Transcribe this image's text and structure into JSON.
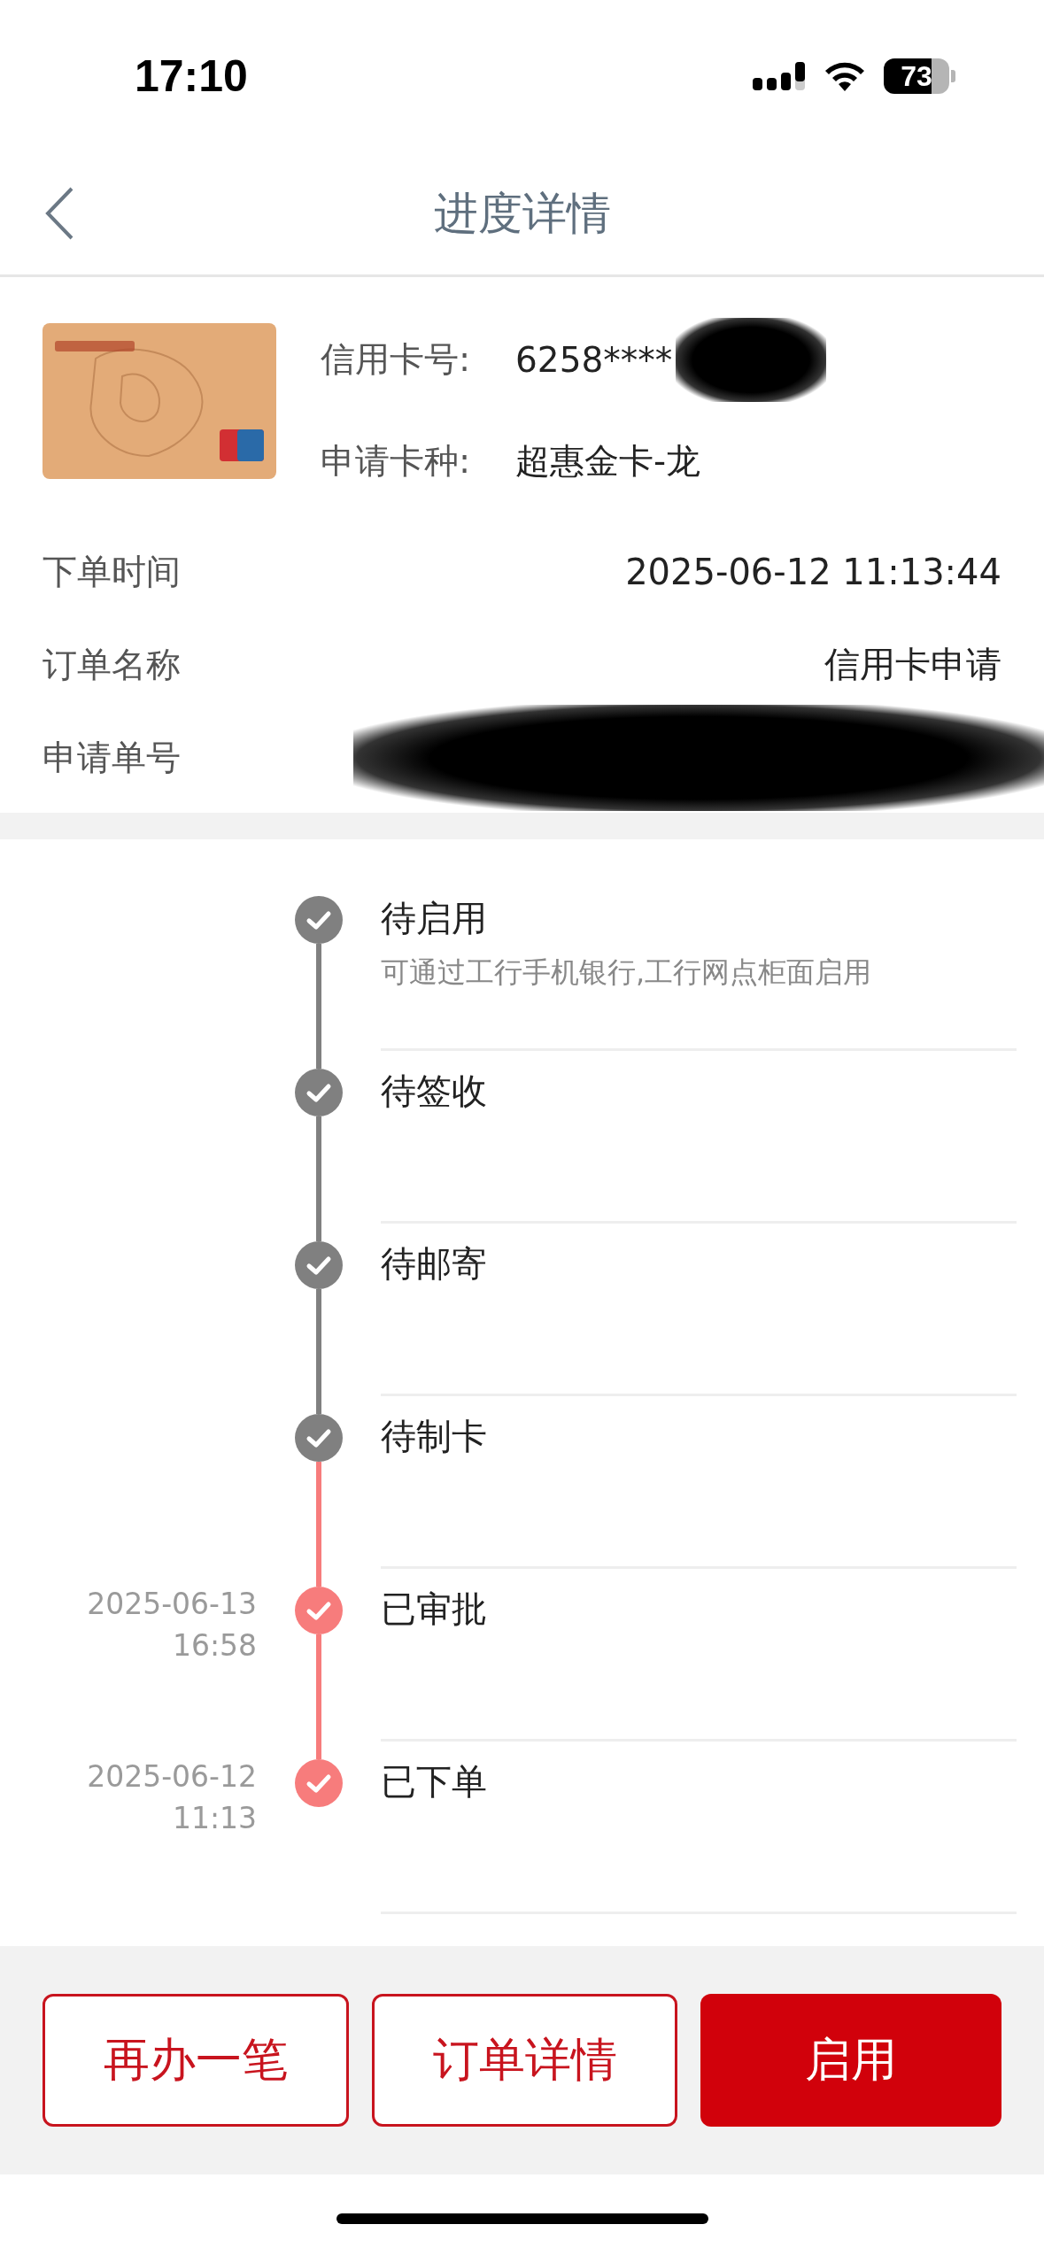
{
  "status_bar": {
    "time": "17:10",
    "battery": "73"
  },
  "nav": {
    "title": "进度详情"
  },
  "card": {
    "kind": "picture",
    "fields": [
      {
        "label": "信用卡号:",
        "value": "6258****",
        "redacted": true
      },
      {
        "label": "申请卡种:",
        "value": "超惠金卡-龙",
        "redacted": false
      }
    ]
  },
  "order_info": [
    {
      "label": "下单时间",
      "value": "2025-06-12 11:13:44",
      "redacted": false
    },
    {
      "label": "订单名称",
      "value": "信用卡申请",
      "redacted": false
    },
    {
      "label": "申请单号",
      "redacted": true
    }
  ],
  "timeline": [
    {
      "title": "待启用",
      "description": "可通过工行手机银行,工行网点柜面启用",
      "color": "#808080"
    },
    {
      "title": "待签收",
      "color": "#808080"
    },
    {
      "title": "待邮寄",
      "color": "#808080"
    },
    {
      "title": "待制卡",
      "color": "#808080"
    },
    {
      "title": "已审批",
      "date": "2025-06-13",
      "time": "16:58",
      "color": "#f77c7c"
    },
    {
      "title": "已下单",
      "date": "2025-06-12",
      "time": "11:13",
      "color": "#f77c7c"
    }
  ],
  "buttons": [
    {
      "label": "再办一笔",
      "kind": "outline"
    },
    {
      "label": "订单详情",
      "kind": "outline"
    },
    {
      "label": "启用",
      "kind": "primary"
    }
  ]
}
